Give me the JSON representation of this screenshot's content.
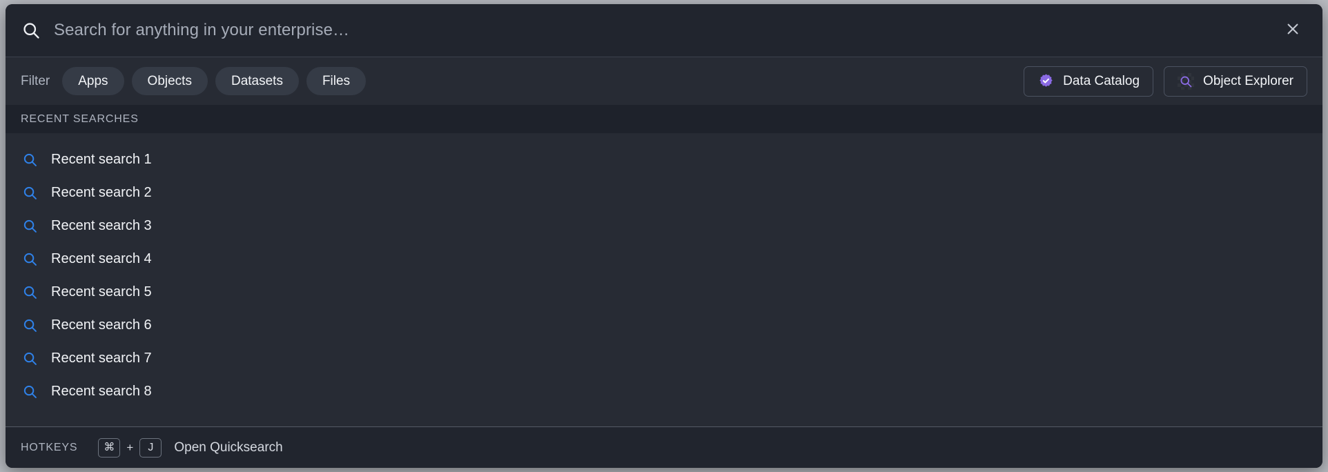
{
  "search": {
    "placeholder": "Search for anything in your enterprise…",
    "value": "",
    "icon": "search-icon",
    "close_icon": "close-icon"
  },
  "filter": {
    "label": "Filter",
    "pills": [
      {
        "label": "Apps"
      },
      {
        "label": "Objects"
      },
      {
        "label": "Datasets"
      },
      {
        "label": "Files"
      }
    ],
    "context_buttons": [
      {
        "label": "Data Catalog",
        "icon": "verified-badge-icon"
      },
      {
        "label": "Object Explorer",
        "icon": "magnifier-icon"
      }
    ]
  },
  "recent": {
    "section_title": "RECENT SEARCHES",
    "items": [
      {
        "label": "Recent search 1",
        "icon": "search-icon"
      },
      {
        "label": "Recent search 2",
        "icon": "search-icon"
      },
      {
        "label": "Recent search 3",
        "icon": "search-icon"
      },
      {
        "label": "Recent search 4",
        "icon": "search-icon"
      },
      {
        "label": "Recent search 5",
        "icon": "search-icon"
      },
      {
        "label": "Recent search 6",
        "icon": "search-icon"
      },
      {
        "label": "Recent search 7",
        "icon": "search-icon"
      },
      {
        "label": "Recent search 8",
        "icon": "search-icon"
      }
    ]
  },
  "hotkeys": {
    "label": "HOTKEYS",
    "keys": [
      {
        "glyph": "⌘"
      },
      {
        "glyph": "J"
      }
    ],
    "separator": "+",
    "action": "Open Quicksearch"
  },
  "colors": {
    "modal_background": "#272b34",
    "bar_background": "#21252e",
    "section_background": "#1e222b",
    "page_background": "#b9bcc2",
    "accent_blue": "#2f81e8",
    "accent_purple": "#8a6ae3",
    "text_primary": "#f2f4f7",
    "text_muted": "#aeb4c0",
    "border": "#4b5260"
  }
}
